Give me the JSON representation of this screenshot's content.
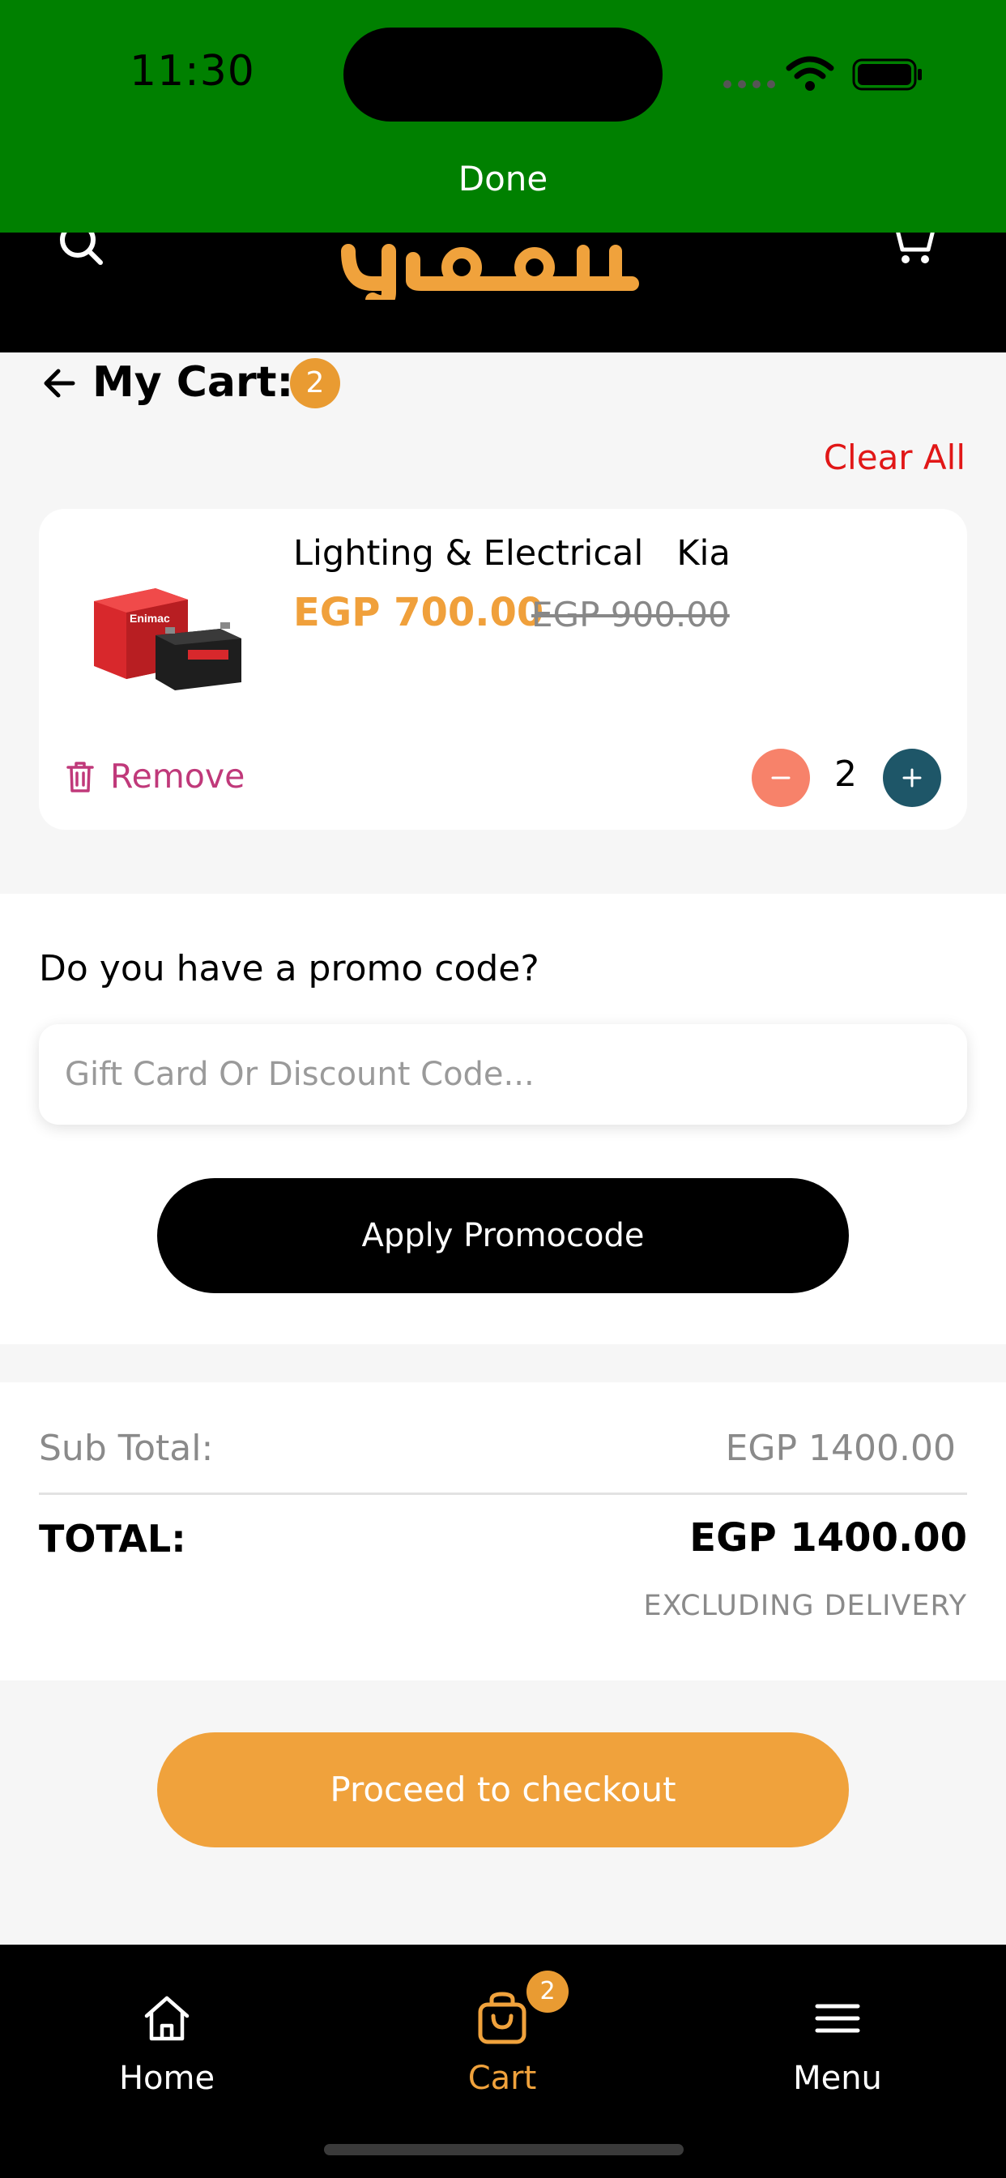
{
  "status_bar": {
    "time": "11:30"
  },
  "top_bar": {
    "done_label": "Done"
  },
  "header": {
    "logo_text": "سدوم"
  },
  "cart": {
    "title": "My Cart:",
    "count": "2",
    "clear_all_label": "Clear All"
  },
  "items": [
    {
      "name": "Lighting & Electrical   Kia",
      "price": "EGP 700.00",
      "old_price": "EGP 900.00",
      "remove_label": "Remove",
      "quantity": "2",
      "image_brand": "Enimac"
    }
  ],
  "promo": {
    "question": "Do you have a promo code?",
    "placeholder": "Gift Card Or Discount Code...",
    "apply_label": "Apply Promocode"
  },
  "totals": {
    "subtotal_label": "Sub Total:",
    "subtotal_value": "EGP 1400.00",
    "total_label": "TOTAL:",
    "total_value": "EGP 1400.00",
    "note": "EXCLUDING DELIVERY"
  },
  "checkout_label": "Proceed to checkout",
  "nav": {
    "home_label": "Home",
    "cart_label": "Cart",
    "cart_badge": "2",
    "menu_label": "Menu"
  },
  "colors": {
    "status_green": "#008000",
    "accent_orange": "#F0A23C",
    "clear_red": "#E11717",
    "remove_pink": "#C0397A",
    "minus_coral": "#F7826A",
    "plus_teal": "#1E5668"
  }
}
